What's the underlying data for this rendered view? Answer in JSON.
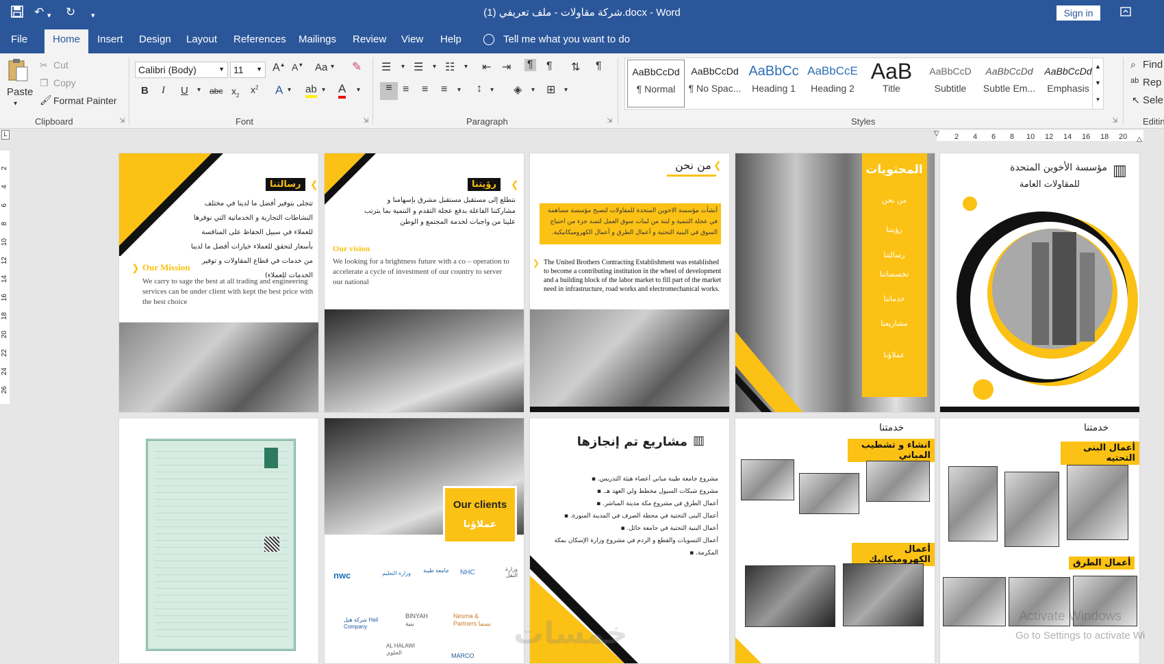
{
  "window": {
    "title": "شركة مقاولات - ملف تعريفي (1).docx  -  Word",
    "signin": "Sign in"
  },
  "qat": {
    "save": "save-icon",
    "undo": "undo-icon",
    "redo": "redo-icon"
  },
  "menu": {
    "file": "File",
    "home": "Home",
    "insert": "Insert",
    "design": "Design",
    "layout": "Layout",
    "references": "References",
    "mailings": "Mailings",
    "review": "Review",
    "view": "View",
    "help": "Help",
    "tell": "Tell me what you want to do"
  },
  "clipboard": {
    "paste": "Paste",
    "cut": "Cut",
    "copy": "Copy",
    "format_painter": "Format Painter",
    "label": "Clipboard"
  },
  "font": {
    "name": "Calibri (Body)",
    "size": "11",
    "label": "Font",
    "aa": "Aa"
  },
  "paragraph": {
    "label": "Paragraph"
  },
  "styles": {
    "label": "Styles",
    "items": [
      {
        "preview": "AaBbCcDd",
        "name": "¶ Normal"
      },
      {
        "preview": "AaBbCcDd",
        "name": "¶ No Spac..."
      },
      {
        "preview": "AaBbCc",
        "name": "Heading 1"
      },
      {
        "preview": "AaBbCcE",
        "name": "Heading 2"
      },
      {
        "preview": "AaB",
        "name": "Title"
      },
      {
        "preview": "AaBbCcD",
        "name": "Subtitle"
      },
      {
        "preview": "AaBbCcDd",
        "name": "Subtle Em..."
      },
      {
        "preview": "AaBbCcDd",
        "name": "Emphasis"
      }
    ]
  },
  "editing": {
    "find": "Find",
    "replace": "Rep",
    "select": "Sele",
    "label": "Editin"
  },
  "ruler": {
    "top": [
      "2",
      "4",
      "6",
      "8",
      "10",
      "12",
      "14",
      "16",
      "18",
      "20"
    ],
    "left": [
      "2",
      "4",
      "6",
      "8",
      "10",
      "12",
      "14",
      "16",
      "18",
      "20",
      "22",
      "24",
      "26"
    ]
  },
  "pages": {
    "p1": {
      "ar_title": "مؤسسة الأخوين المتحدة",
      "ar_sub": "للمقاولات العامة"
    },
    "p2": {
      "title": "المحتويات",
      "items": [
        "من نحن",
        "رؤيتنا",
        "رسالتنا",
        "تخصصاتنا",
        "خدماتنا",
        "مشاريعنا",
        "عملاؤنا"
      ]
    },
    "p3": {
      "title": "من نحن",
      "ar_body": "أنشأت مؤسسة الاخوين المتحدة للمقاولات لتصبح مؤسسة مساهمة في عجلة التنمية و لبنة من لبنات سوق العمل لتسد جزء من احتياج السوق في البنية التحتية و أعمال الطرق و أعمال الكهروميكانيكية.",
      "en_body": "The United Brothers Contracting Establishment was established to become a contributing institution in the wheel of development and a building block of the labor market to fill part of the market need in infrastructure, road works and electromechanical works."
    },
    "p4": {
      "title": "رؤيتنا",
      "ar_body": "نتطلع إلى مستقبل مستقبل مشرق بإسهامنا و مشاركتنا الفاعلة بدفع عجلة التقدم و التنمية بما يترتب علينا من واجبات لخدمة المجتمع و الوطن",
      "en_title": "Our vision",
      "en_body": "We looking for a brightness future with a co – operation to accelerate a cycle of investment of our country to server our national"
    },
    "p5": {
      "title": "رسالتنا",
      "ar_body": "تتجلى بتوفير أفضل ما لدينا في مختلف النشاطات التجارية و الخدماتية التي نوفرها للعملاء في سبيل الحفاظ على المنافسة بأسعار لتحقق للعملاء خيارات أفضل ما لدينا من خدمات في قطاع المقاولات و توفير الخدمات للعملاء)",
      "en_title": "Our Mission",
      "en_body": "We carry to sage the best at all trading and engineering services can be under client with kept the best price with the best choice"
    },
    "p6": {
      "title": "خدمتنا",
      "label1": "أعمال البنى التحتيه",
      "label2": "أعمال الطرق"
    },
    "p7": {
      "title": "خدمتنا",
      "label1": "انشاء و تشطيب المباني",
      "label2": "أعمال الكهروميكانيك"
    },
    "p8": {
      "title": "مشاريع تم إنجازها",
      "items": [
        "مشروع جامعة طيبة مباني أعضاء هيئة التدريس.",
        "مشروع شبكات السيول مخطط ولي العهد هـ.",
        "أعمال الطرق في مشروع مكة مدينة المباشر.",
        "أعمال البنى التحتية في محطة الصرف في المدينة المنورة.",
        "أعمال البنية التحتية في جامعة حائل.",
        "أعمال التسويات والقطع و الردم في مشروع وزارة الإسكان بمكة المكرمة."
      ]
    },
    "p9": {
      "en_title": "Our clients",
      "ar_title": "عملاؤنا",
      "logos": [
        "nwc",
        "وزارة التعليم",
        "جامعة طيبة",
        "NHC",
        "وزارة النقل",
        "شركة هيل Hail Company",
        "BINYAH بنية",
        "Nesma & Partners نسما",
        "AL HALAWI الحلوي",
        "MARCO"
      ]
    },
    "p10": {
      "doc": "certificate"
    }
  },
  "watermark": {
    "line1": "Activate Windows",
    "line2": "Go to Settings to activate Wi",
    "site": "خمسات"
  },
  "colors": {
    "ribbon_blue": "#2b579a",
    "accent_yellow": "#fbc114"
  }
}
